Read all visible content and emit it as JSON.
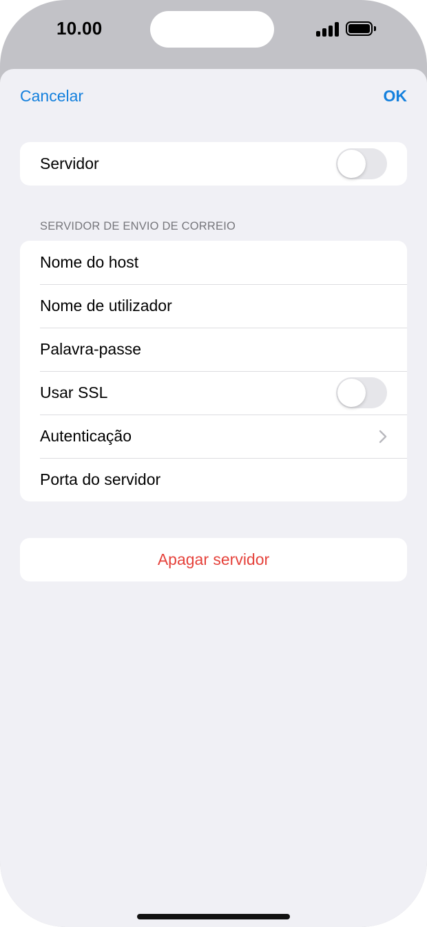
{
  "status_bar": {
    "time": "10.00"
  },
  "nav": {
    "cancel": "Cancelar",
    "ok": "OK"
  },
  "server_group": {
    "label": "Servidor",
    "toggle_on": false
  },
  "outgoing": {
    "header": "SERVIDOR DE ENVIO DE CORREIO",
    "rows": [
      {
        "label": "Nome do host"
      },
      {
        "label": "Nome de utilizador"
      },
      {
        "label": "Palavra-passe"
      },
      {
        "label": "Usar SSL",
        "toggle_on": false
      },
      {
        "label": "Autenticação"
      },
      {
        "label": "Porta do servidor"
      }
    ]
  },
  "delete": {
    "label": "Apagar servidor"
  },
  "colors": {
    "accent": "#1480dd",
    "destructive": "#e5423b",
    "background": "#f0f0f5"
  },
  "icons": {
    "signal": "cellular-signal-icon",
    "battery": "battery-icon",
    "chevron": "chevron-right-icon"
  }
}
